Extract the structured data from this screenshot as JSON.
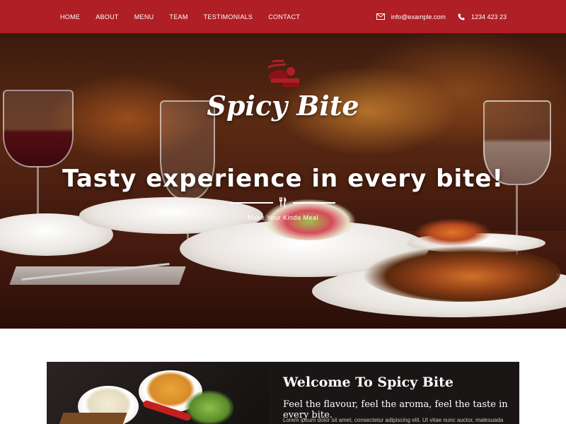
{
  "nav": {
    "items": [
      {
        "label": "HOME"
      },
      {
        "label": "ABOUT"
      },
      {
        "label": "MENU"
      },
      {
        "label": "TEAM"
      },
      {
        "label": "TESTIMONIALS"
      },
      {
        "label": "CONTACT"
      }
    ],
    "email": "info@example.com",
    "email_icon": "envelope-icon",
    "phone": "1234 423 23",
    "phone_icon": "phone-icon"
  },
  "hero": {
    "logo_icon": "chef-cloche-icon",
    "brand": "Spicy Bite",
    "tagline": "Tasty experience in every bite!",
    "divider_icon": "fork-knife-icon",
    "subtag": "Make Your Kinda Meal"
  },
  "welcome": {
    "title": "Welcome To Spicy Bite",
    "subtitle": "Feel the flavour, feel the aroma, feel the taste in every bite.",
    "body": "Lorem ipsum dolor sit amet, consectetur adipiscing elit. Ut vitae nunc auctor, malesuada"
  },
  "colors": {
    "brand_red": "#b01e26",
    "dark_panel": "#1a1616"
  }
}
